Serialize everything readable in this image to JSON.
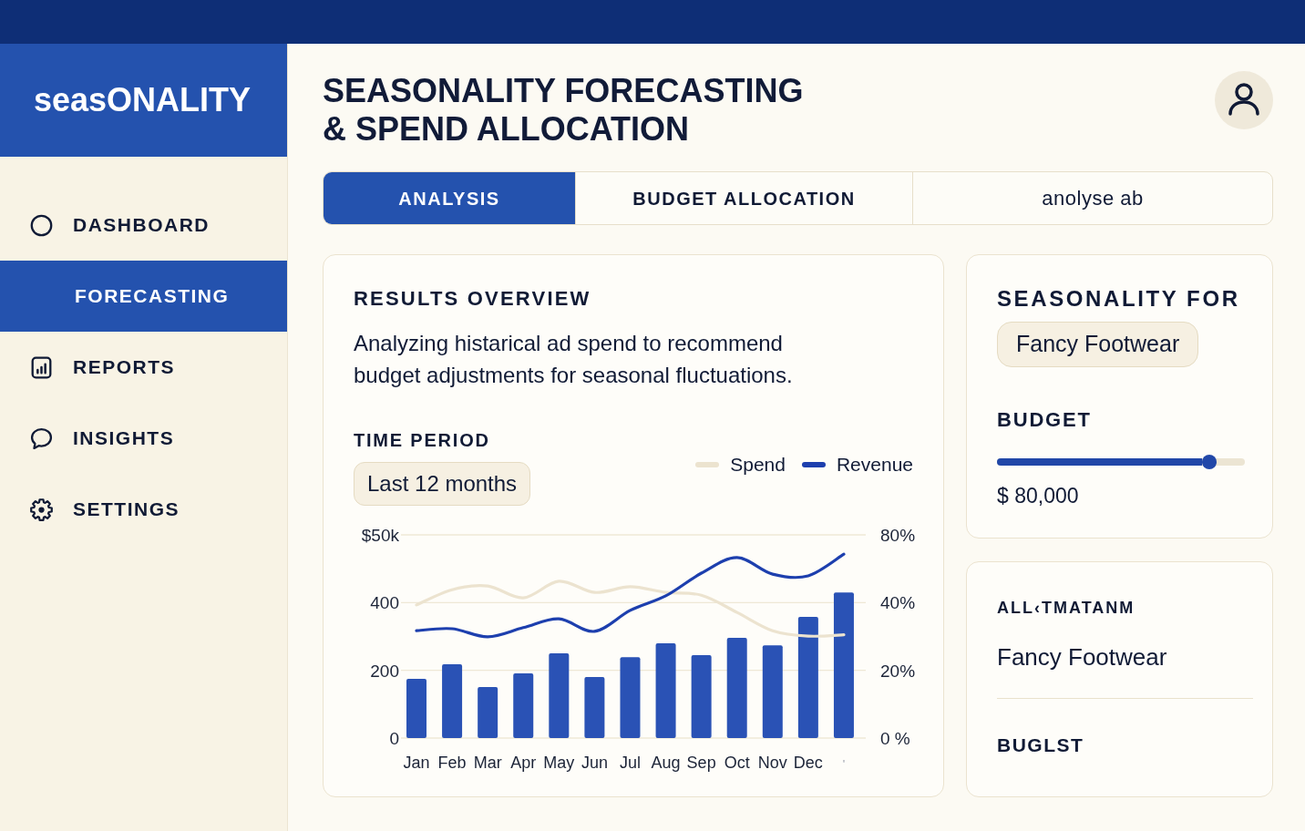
{
  "sidebar": {
    "logo": "seasONALITY",
    "items": [
      {
        "label": "DASHBOARD",
        "selected": false
      },
      {
        "label": "FORECASTING",
        "selected": true
      },
      {
        "label": "REPORTS",
        "selected": false
      },
      {
        "label": "INSIGHTS",
        "selected": false
      },
      {
        "label": "SETTINGS",
        "selected": false
      }
    ]
  },
  "header": {
    "title": "SEASONALITY FORECASTING & SPEND ALLOCATION"
  },
  "tabs": [
    {
      "label": "ANALYSIS",
      "kind": "heading",
      "selected": true
    },
    {
      "label": "BUDGET ALLOCATION",
      "kind": "heading",
      "selected": false
    },
    {
      "label": "anolyse ab",
      "kind": "plain",
      "selected": false
    }
  ],
  "results_card": {
    "title": "RESULTS OVERVIEW",
    "description": "Analyzing histarical ad spend to recommend budget adjustments for seasonal fluctuations.",
    "time_period": {
      "label": "TIME PERIOD",
      "value": "Last 12 months"
    },
    "chart_data": {
      "type": "bar",
      "categories": [
        "Jan",
        "Feb",
        "Mar",
        "Apr",
        "May",
        "Jun",
        "Jul",
        "Aug",
        "Sep",
        "Oct",
        "Nov",
        "Dec",
        "'"
      ],
      "series": [
        {
          "color": "#2a52b5",
          "values": [
            175,
            218,
            151,
            191,
            250,
            180,
            239,
            280,
            245,
            296,
            274,
            358,
            430
          ]
        },
        {
          "name": "Spend",
          "type": "line",
          "color": "#ece3cf",
          "values": [
            393,
            438,
            449,
            414,
            463,
            430,
            447,
            430,
            422,
            371,
            317,
            301,
            305
          ]
        },
        {
          "name": "Revenue",
          "type": "line",
          "color": "#1d3fae",
          "values": [
            317,
            323,
            299,
            326,
            352,
            315,
            377,
            420,
            487,
            533,
            484,
            479,
            543
          ]
        }
      ],
      "ylabel": "$50k",
      "ylim": [
        0,
        600
      ],
      "yticks": [
        0,
        200,
        400
      ],
      "y2label": "80%",
      "y2lim": [
        0,
        60
      ],
      "y2ticks": [
        {
          "value": 0,
          "label": "0 %"
        },
        {
          "value": 20,
          "label": "20%"
        },
        {
          "value": 40,
          "label": "40%"
        }
      ]
    }
  },
  "seasonality_card": {
    "label": "SEASONALITY FOR",
    "selection": "Fancy Footwear",
    "budget": {
      "label": "BUDGET",
      "level": 0.857,
      "reading": "$ 80,000"
    }
  },
  "allocation_card": {
    "title": "ALL‹TMATANM",
    "value": "Fancy Footwear",
    "footer_label": "BUGLST"
  }
}
